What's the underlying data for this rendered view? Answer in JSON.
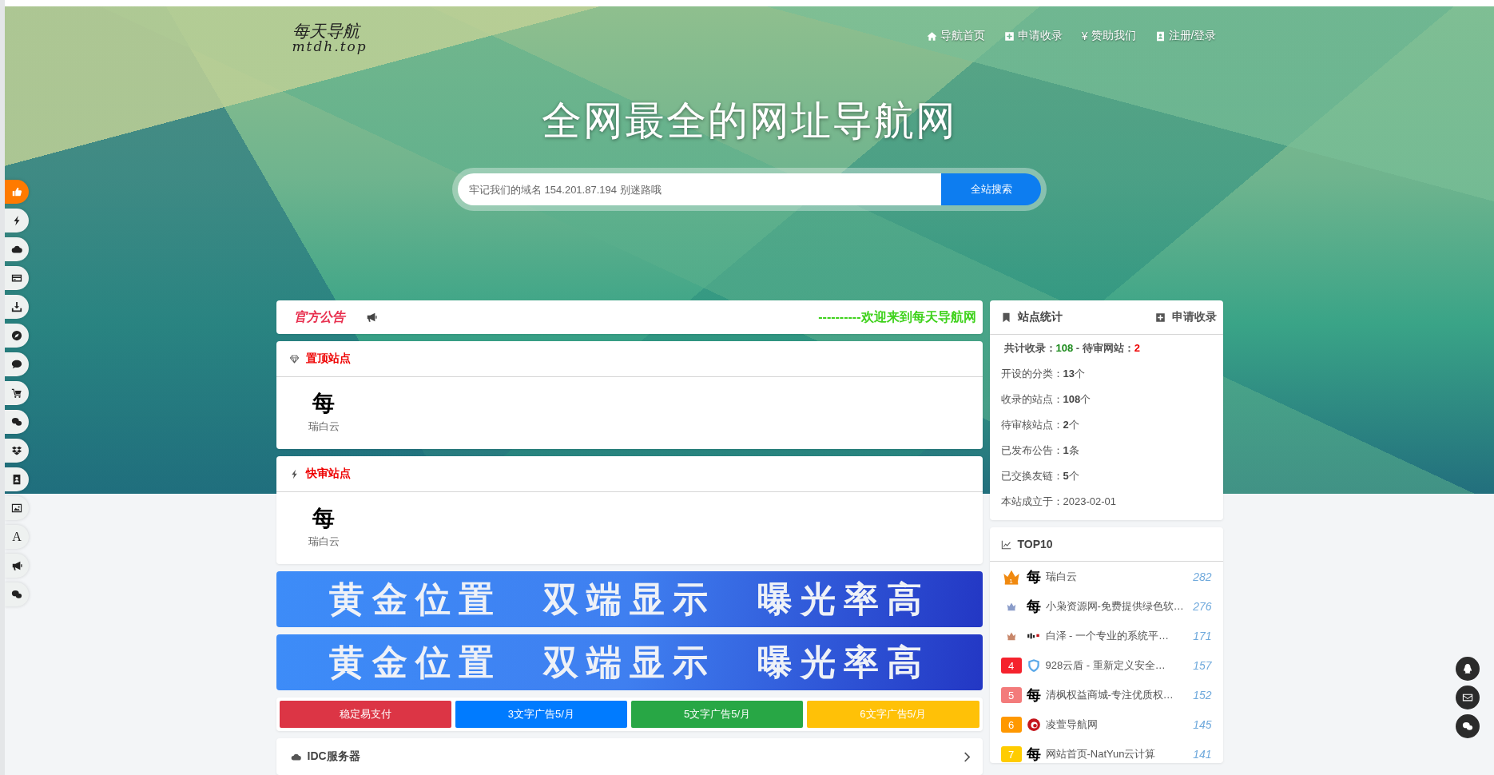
{
  "logo": {
    "line1": "每天导航",
    "line2": "mtdh.top"
  },
  "nav": [
    {
      "label": "导航首页"
    },
    {
      "label": "申请收录"
    },
    {
      "glyph": "¥",
      "label": "赞助我们"
    },
    {
      "label": "注册/登录"
    }
  ],
  "hero": {
    "title": "全网最全的网址导航网",
    "search": {
      "placeholder": "牢记我们的域名 154.201.87.194 别迷路哦",
      "button": "全站搜索"
    }
  },
  "sidebar": [
    {
      "selected": true
    },
    {
      "selected": false
    },
    {
      "selected": false
    },
    {
      "selected": false
    },
    {
      "selected": false
    },
    {
      "selected": false
    },
    {
      "selected": false
    },
    {
      "selected": false
    },
    {
      "selected": false
    },
    {
      "selected": false
    },
    {
      "selected": false
    },
    {
      "selected": false
    },
    {
      "glyph": "A",
      "selected": false
    },
    {
      "selected": false
    },
    {
      "selected": false
    }
  ],
  "notice": {
    "title": "官方公告",
    "marquee": "----------欢迎来到每天导航网"
  },
  "sections": [
    {
      "title": "置顶站点",
      "sites": [
        {
          "glyph": "每",
          "name": "瑞白云"
        }
      ]
    },
    {
      "title": "快审站点",
      "sites": [
        {
          "glyph": "每",
          "name": "瑞白云"
        }
      ]
    }
  ],
  "banners": [
    {
      "parts": [
        "黄金位置",
        "双端显示",
        "曝光率高"
      ]
    },
    {
      "parts": [
        "黄金位置",
        "双端显示",
        "曝光率高"
      ]
    }
  ],
  "text_ads": [
    {
      "label": "稳定易支付",
      "color": "#dc3545"
    },
    {
      "label": "3文字广告5/月",
      "color": "#007bff"
    },
    {
      "label": "5文字广告5/月",
      "color": "#28a745"
    },
    {
      "label": "6文字广告5/月",
      "color": "#ffc107"
    }
  ],
  "category": {
    "title": "IDC服务器"
  },
  "stats": {
    "title": "站点统计",
    "action": "申请收录",
    "summary": {
      "total_label": "共计收录：",
      "total": "108",
      "pending_label": " - 待审网站：",
      "pending": "2"
    },
    "rows": [
      {
        "label": "开设的分类：",
        "value": "13",
        "unit": "个"
      },
      {
        "label": "收录的站点：",
        "value": "108",
        "unit": "个"
      },
      {
        "label": "待审核站点：",
        "value": "2",
        "unit": "个"
      },
      {
        "label": "已发布公告：",
        "value": "1",
        "unit": "条"
      },
      {
        "label": "已交换友链：",
        "value": "5",
        "unit": "个"
      },
      {
        "label": "本站成立于：",
        "value": "2023-02-01"
      }
    ]
  },
  "top10": {
    "title": "TOP10",
    "items": [
      {
        "kind": "crown",
        "color": "#f0890f",
        "rank": "1",
        "glyph": "每",
        "name": "瑞白云",
        "count": "282"
      },
      {
        "kind": "crown",
        "color": "#8a9cc9",
        "glyph": "每",
        "name": "小枭资源网-免费提供绿色软…",
        "count": "276"
      },
      {
        "kind": "crown",
        "color": "#c8876a",
        "name": "白泽 - 一个专业的系统平…",
        "count": "171"
      },
      {
        "kind": "badge",
        "color": "#f5222d",
        "rank": "4",
        "name": "928云盾 - 重新定义安全…",
        "count": "157"
      },
      {
        "kind": "badge",
        "color": "#f37b7b",
        "rank": "5",
        "glyph": "每",
        "name": "清枫权益商城-专注优质权…",
        "count": "152"
      },
      {
        "kind": "badge",
        "color": "#ff9800",
        "rank": "6",
        "name": "凌萱导航网",
        "count": "145"
      },
      {
        "kind": "badge",
        "color": "#ffcc00",
        "rank": "7",
        "glyph": "每",
        "name": "网站首页-NatYun云计算",
        "count": "141"
      }
    ]
  }
}
